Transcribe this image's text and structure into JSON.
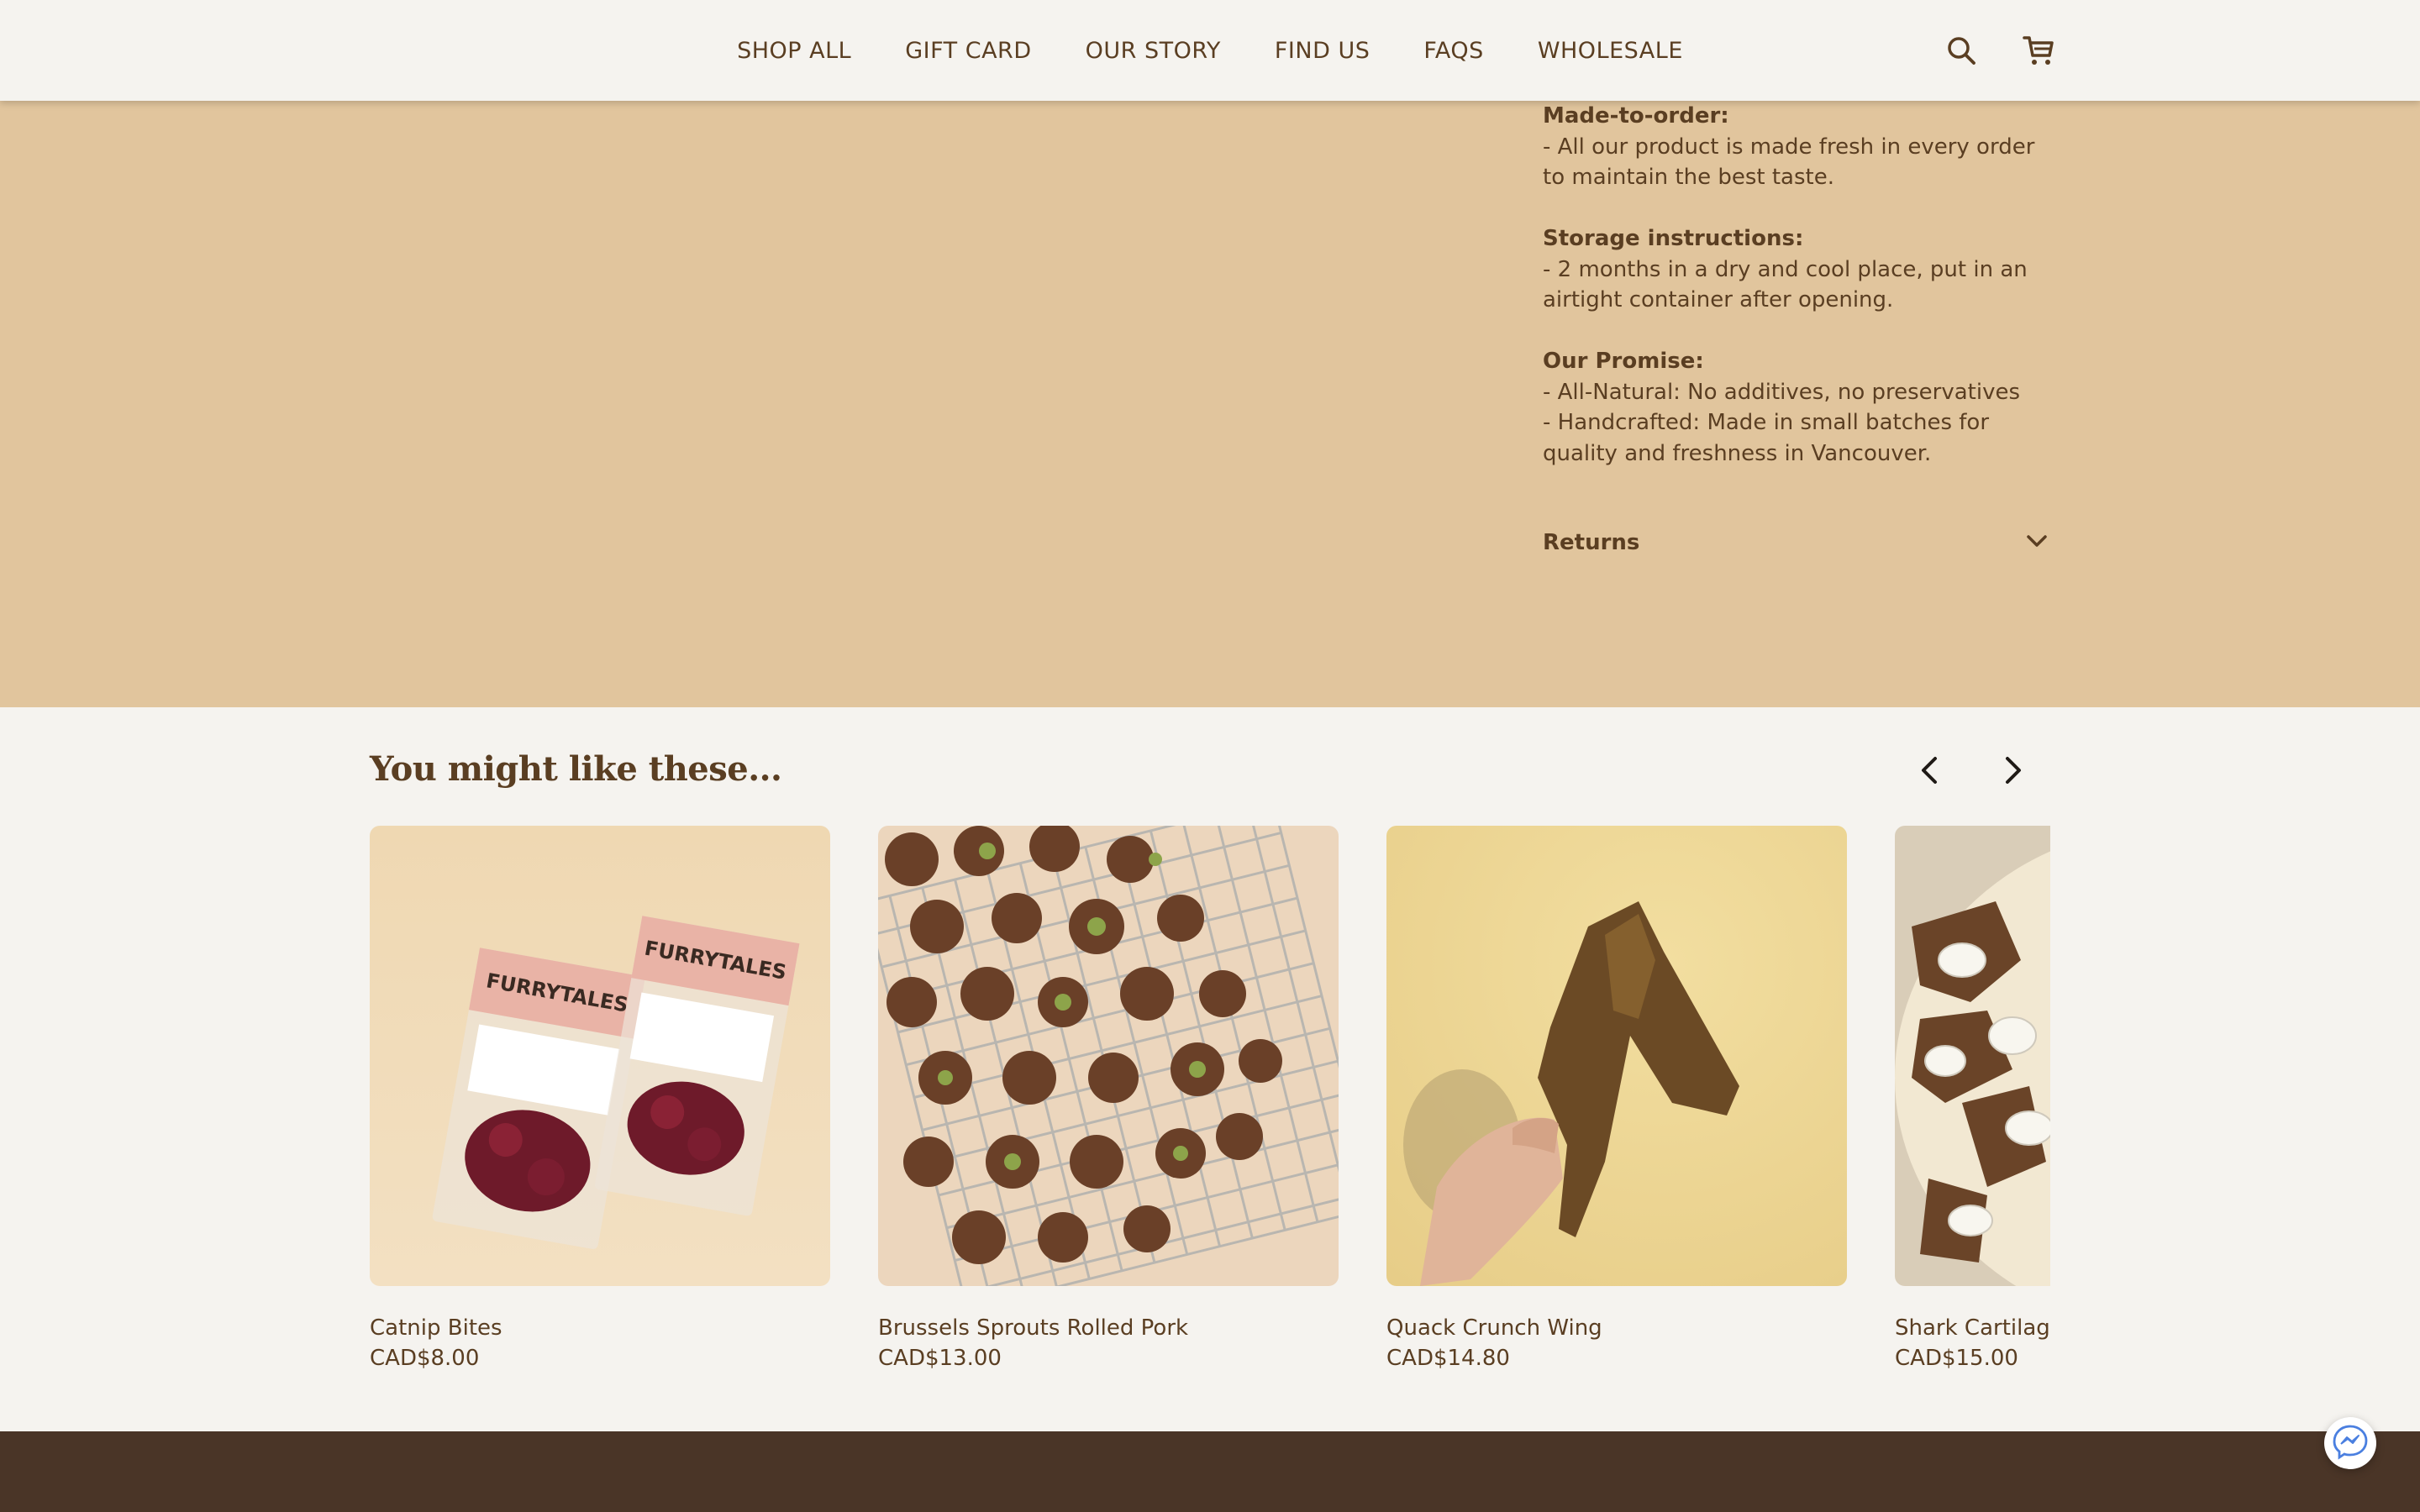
{
  "nav": {
    "items": [
      "SHOP ALL",
      "GIFT CARD",
      "OUR STORY",
      "FIND US",
      "FAQS",
      "WHOLESALE"
    ],
    "search_icon": "search-icon",
    "cart_icon": "cart-icon"
  },
  "product": {
    "description": [
      {
        "heading": "Made-to-order:",
        "lines": [
          "- All our product is made fresh in every order to maintain the best taste."
        ]
      },
      {
        "heading": "Storage instructions:",
        "lines": [
          "- 2 months in a dry and cool place, put in an airtight container after opening."
        ]
      },
      {
        "heading": "Our Promise:",
        "lines": [
          "- All-Natural: No additives, no preservatives",
          "- Handcrafted: Made in small batches for quality and freshness in Vancouver."
        ]
      }
    ],
    "returns_label": "Returns"
  },
  "recommendations": {
    "title": "You might like these...",
    "items": [
      {
        "name": "Catnip Bites",
        "price": "CAD$8.00",
        "image": "catnip-bites-photo"
      },
      {
        "name": "Brussels Sprouts Rolled Pork",
        "price": "CAD$13.00",
        "image": "brussels-sprouts-pork-photo"
      },
      {
        "name": "Quack Crunch Wing",
        "price": "CAD$14.80",
        "image": "duck-wing-photo"
      },
      {
        "name": "Shark Cartilage",
        "price": "CAD$15.00",
        "image": "shark-cartilage-photo"
      }
    ]
  },
  "colors": {
    "accent_text": "#5a3e22",
    "product_bg": "#e1c59d",
    "page_bg": "#f5f3ef",
    "footer_bg": "#4a3527"
  }
}
